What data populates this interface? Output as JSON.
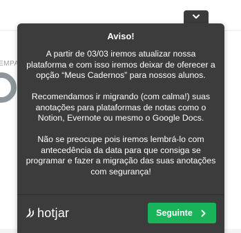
{
  "background": {
    "partial_label": "EMPA"
  },
  "widget": {
    "title": "Aviso!",
    "paragraphs": [
      "A partir de 03/03 iremos atualizar nossa plataforma e com isso iremos deixar de oferecer a opção “Meus Cadernos” para nossos alunos.",
      "Recomendamos ir migrando (com calma!) suas anotações para plataformas de notas como o Notion, Evernote ou mesmo o Google Docs.",
      "Não se preocupe pois iremos lembrá-lo com antecedência da data para que consiga se programar e fazer a migração das suas anotações com segurança!"
    ],
    "brand": "hotjar",
    "next_label": "Seguinte",
    "colors": {
      "panel": "#3c3c3c",
      "button": "#19b35a",
      "text": "#ffffff"
    }
  },
  "icons": {
    "toggle": "chevron-down-icon",
    "next": "chevron-right-icon",
    "logo": "hotjar-logo-icon"
  }
}
